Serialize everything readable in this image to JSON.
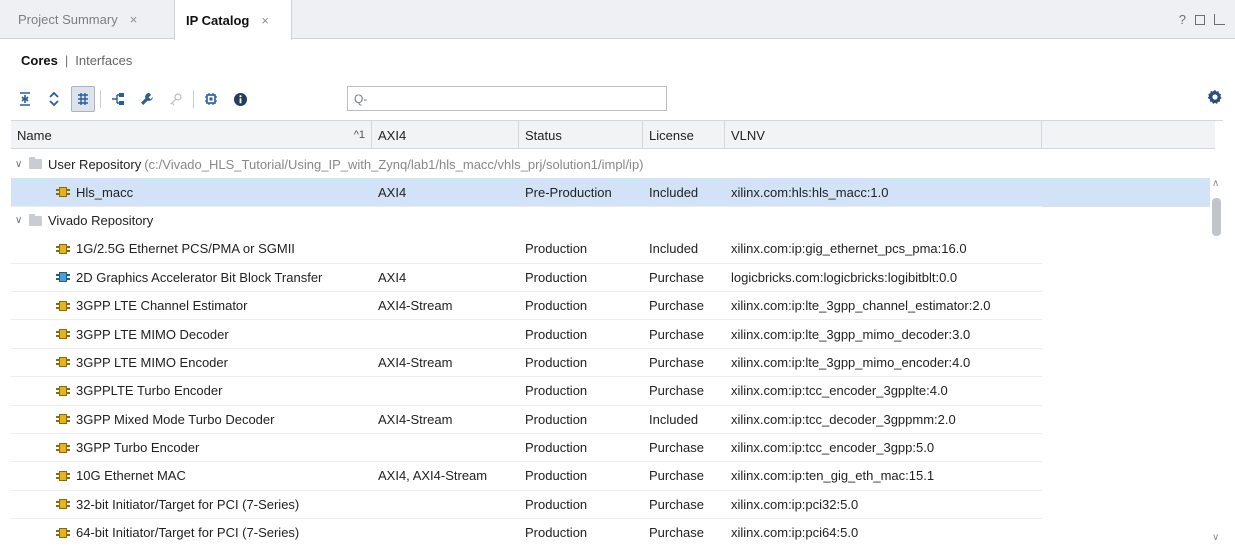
{
  "tabs": [
    {
      "label": "Project Summary",
      "close": "×",
      "active": false
    },
    {
      "label": "IP Catalog",
      "close": "×",
      "active": true
    }
  ],
  "window_buttons": {
    "help": "?"
  },
  "subtabs": {
    "cores": "Cores",
    "separator": "|",
    "interfaces": "Interfaces"
  },
  "toolbar": {
    "search_placeholder": "Q-",
    "buttons": [
      "collapse-all-icon",
      "expand-all-icon",
      "group-by-icon",
      "hierarchy-icon",
      "wrench-icon",
      "key-icon",
      "chip-icon",
      "info-icon"
    ]
  },
  "table": {
    "columns": [
      {
        "label": "Name",
        "sort": "^1"
      },
      {
        "label": "AXI4"
      },
      {
        "label": "Status"
      },
      {
        "label": "License"
      },
      {
        "label": "VLNV"
      }
    ],
    "groups": [
      {
        "label": "User Repository",
        "path": "(c:/Vivado_HLS_Tutorial/Using_IP_with_Zynq/lab1/hls_macc/vhls_prj/solution1/impl/ip)",
        "rows": [
          {
            "name": "Hls_macc",
            "axi4": "AXI4",
            "status": "Pre-Production",
            "license": "Included",
            "vlnv": "xilinx.com:hls:hls_macc:1.0",
            "icon": "yellow",
            "selected": true
          }
        ]
      },
      {
        "label": "Vivado Repository",
        "path": "",
        "rows": [
          {
            "name": "1G/2.5G Ethernet PCS/PMA or SGMII",
            "axi4": "",
            "status": "Production",
            "license": "Included",
            "vlnv": "xilinx.com:ip:gig_ethernet_pcs_pma:16.0",
            "icon": "yellow"
          },
          {
            "name": "2D Graphics Accelerator Bit Block Transfer",
            "axi4": "AXI4",
            "status": "Production",
            "license": "Purchase",
            "vlnv": "logicbricks.com:logicbricks:logibitblt:0.0",
            "icon": "blue"
          },
          {
            "name": "3GPP LTE Channel Estimator",
            "axi4": "AXI4-Stream",
            "status": "Production",
            "license": "Purchase",
            "vlnv": "xilinx.com:ip:lte_3gpp_channel_estimator:2.0",
            "icon": "yellow"
          },
          {
            "name": "3GPP LTE MIMO Decoder",
            "axi4": "",
            "status": "Production",
            "license": "Purchase",
            "vlnv": "xilinx.com:ip:lte_3gpp_mimo_decoder:3.0",
            "icon": "yellow"
          },
          {
            "name": "3GPP LTE MIMO Encoder",
            "axi4": "AXI4-Stream",
            "status": "Production",
            "license": "Purchase",
            "vlnv": "xilinx.com:ip:lte_3gpp_mimo_encoder:4.0",
            "icon": "yellow"
          },
          {
            "name": "3GPPLTE Turbo Encoder",
            "axi4": "",
            "status": "Production",
            "license": "Purchase",
            "vlnv": "xilinx.com:ip:tcc_encoder_3gpplte:4.0",
            "icon": "yellow"
          },
          {
            "name": "3GPP Mixed Mode Turbo Decoder",
            "axi4": "AXI4-Stream",
            "status": "Production",
            "license": "Included",
            "vlnv": "xilinx.com:ip:tcc_decoder_3gppmm:2.0",
            "icon": "yellow"
          },
          {
            "name": "3GPP Turbo Encoder",
            "axi4": "",
            "status": "Production",
            "license": "Purchase",
            "vlnv": "xilinx.com:ip:tcc_encoder_3gpp:5.0",
            "icon": "yellow"
          },
          {
            "name": "10G Ethernet MAC",
            "axi4": "AXI4, AXI4-Stream",
            "status": "Production",
            "license": "Purchase",
            "vlnv": "xilinx.com:ip:ten_gig_eth_mac:15.1",
            "icon": "yellow"
          },
          {
            "name": "32-bit Initiator/Target for PCI (7-Series)",
            "axi4": "",
            "status": "Production",
            "license": "Purchase",
            "vlnv": "xilinx.com:ip:pci32:5.0",
            "icon": "yellow"
          },
          {
            "name": "64-bit Initiator/Target for PCI (7-Series)",
            "axi4": "",
            "status": "Production",
            "license": "Purchase",
            "vlnv": "xilinx.com:ip:pci64:5.0",
            "icon": "yellow"
          }
        ]
      }
    ]
  },
  "colors": {
    "selected_row": "#d2e2f7",
    "ip_icon_yellow": "#e7b318",
    "ip_icon_blue": "#4aa0d6",
    "toolbar_icon": "#2a5d9f"
  }
}
